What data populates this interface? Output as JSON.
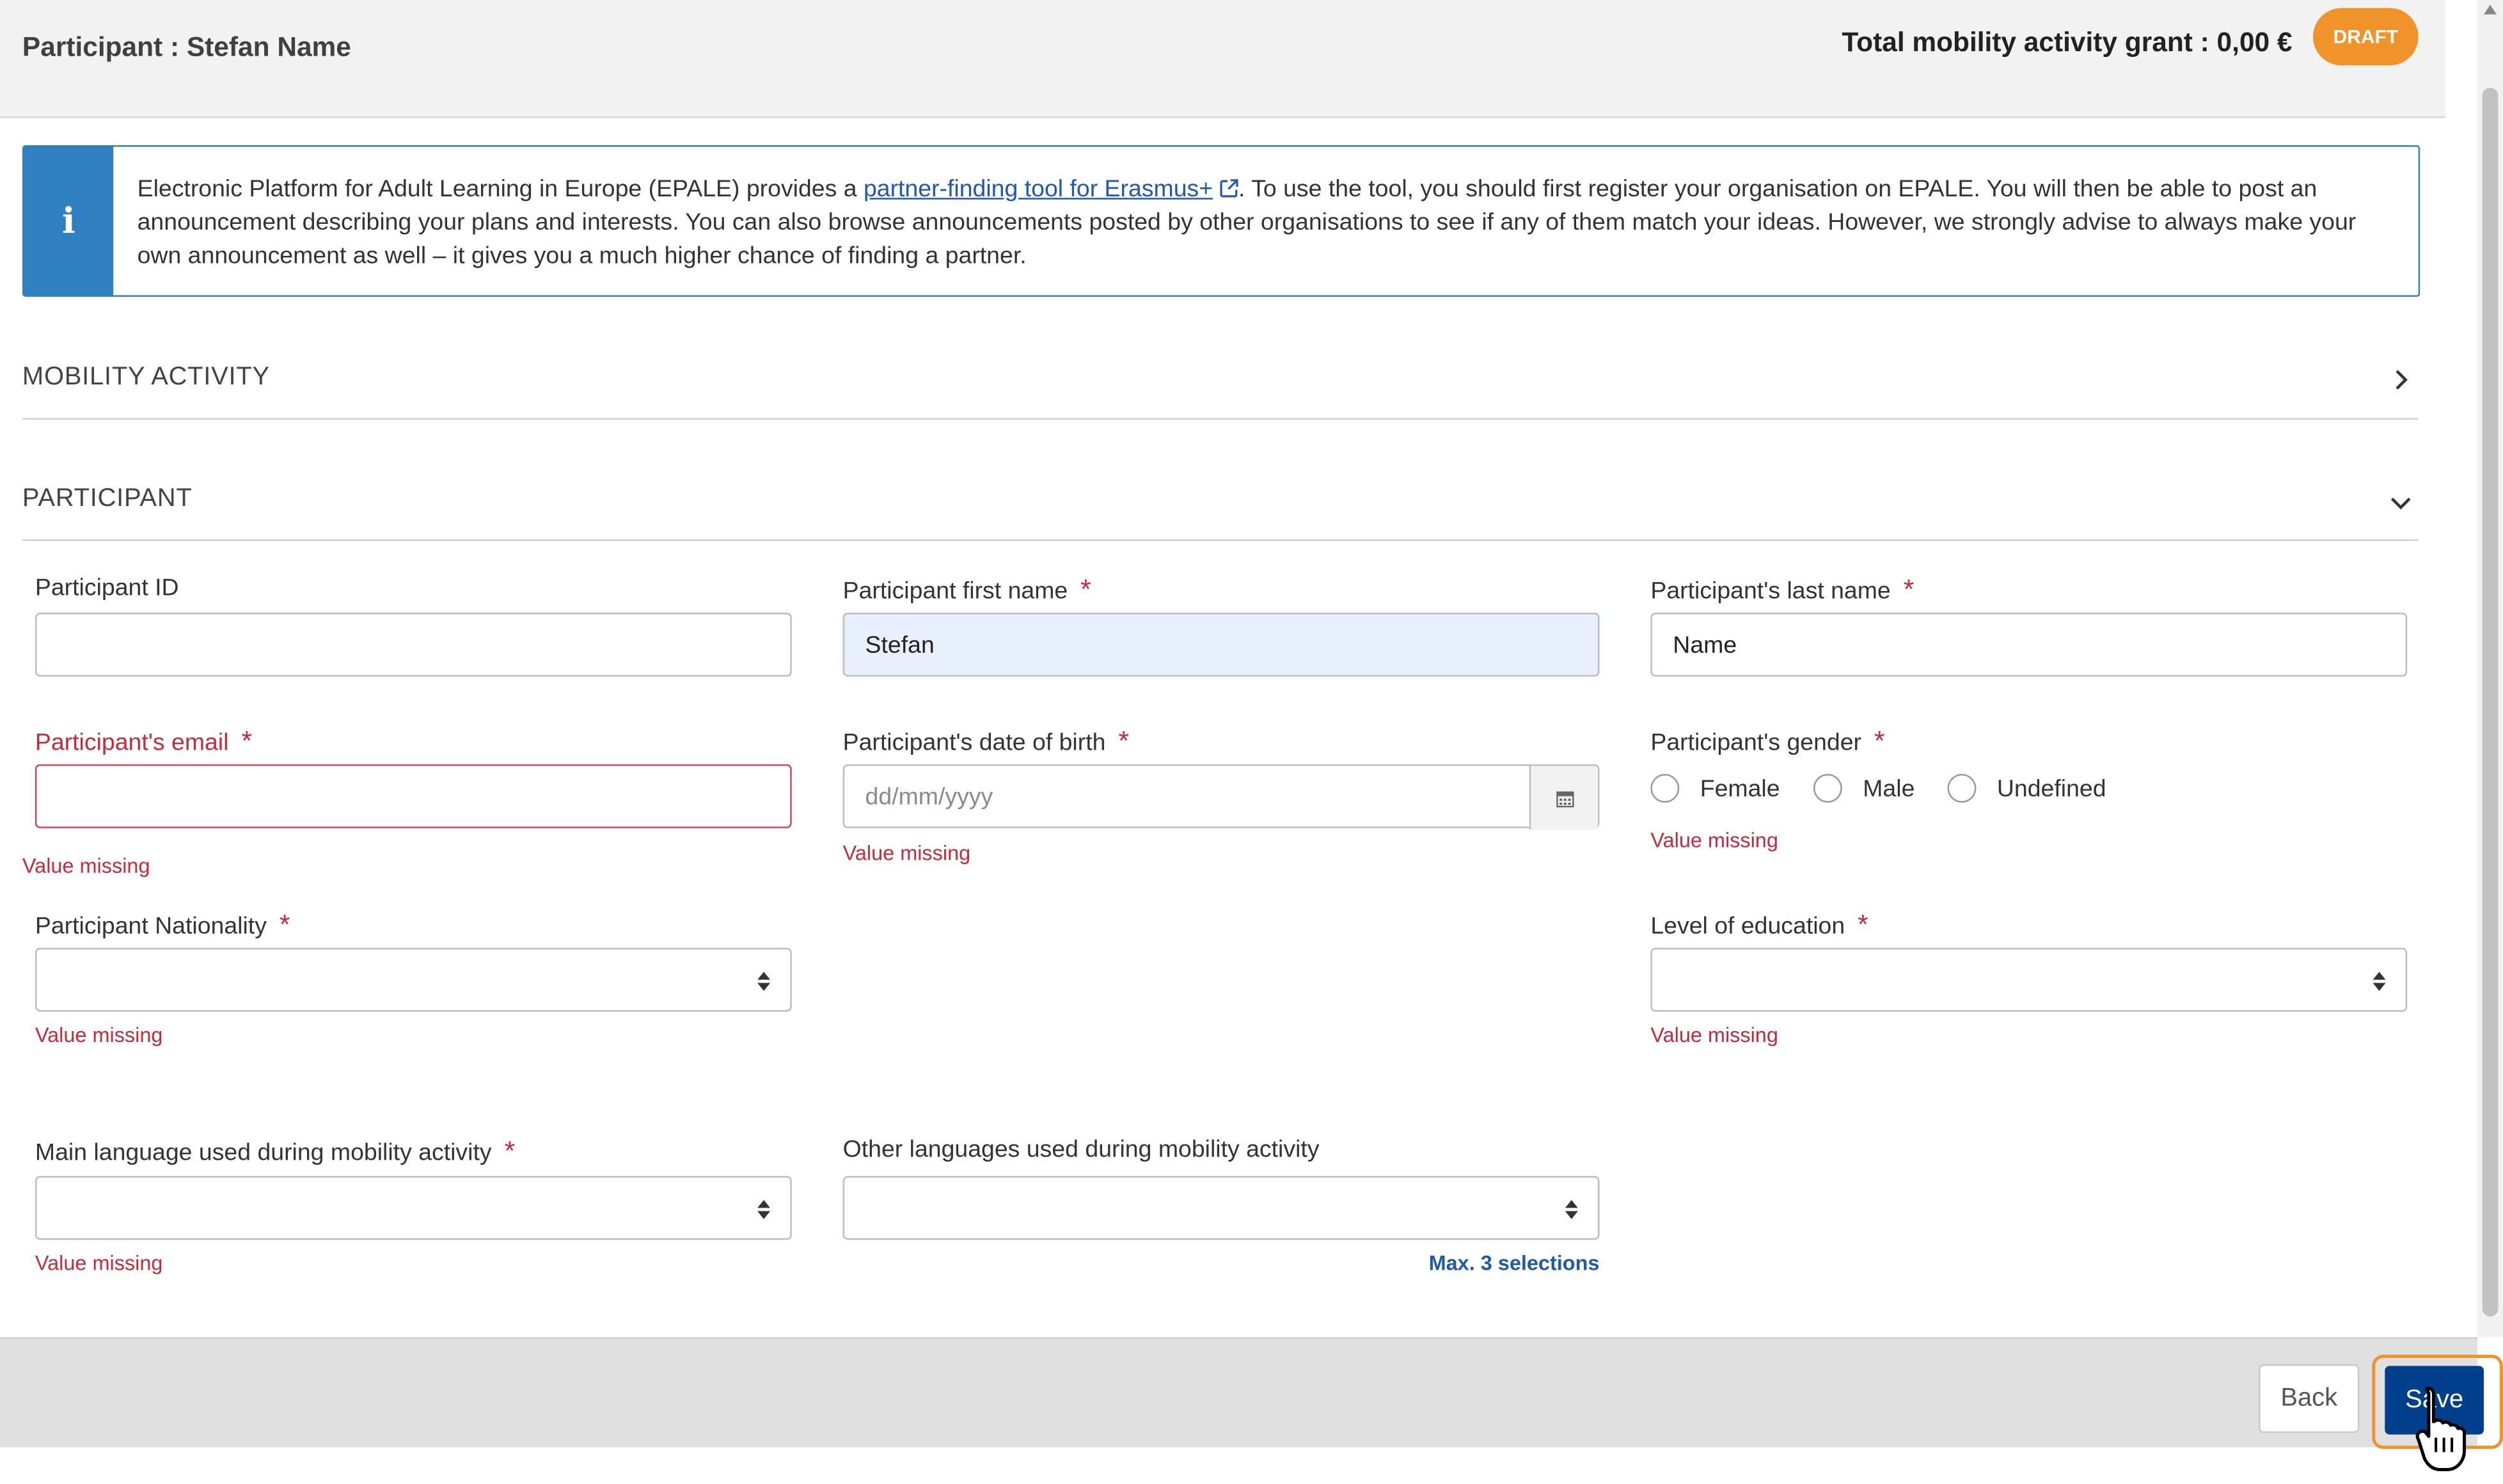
{
  "header": {
    "title": "Participant : Stefan Name",
    "grant": "Total mobility activity grant : 0,00 €",
    "status_badge": "DRAFT"
  },
  "info": {
    "text_before": "Electronic Platform for Adult Learning in Europe (EPALE) provides a ",
    "link": "partner-finding tool for Erasmus+",
    "text_after": ". To use the tool, you should first register your organisation on EPALE. You will then be able to post an announcement describing your plans and interests. You can also browse announcements posted by other organisations to see if any of them match your ideas. However, we strongly advise to always make your own announcement as well – it gives you a much higher chance of finding a partner."
  },
  "sections": {
    "mobility_activity": "MOBILITY ACTIVITY",
    "participant": "PARTICIPANT"
  },
  "form": {
    "participant_id": {
      "label": "Participant ID",
      "value": ""
    },
    "first_name": {
      "label": "Participant first name",
      "required": "*",
      "value": "Stefan"
    },
    "last_name": {
      "label": "Participant's last name",
      "required": "*",
      "value": "Name"
    },
    "email": {
      "label": "Participant's email",
      "required": "*",
      "value": "",
      "error": "Value missing"
    },
    "dob": {
      "label": "Participant's date of birth",
      "required": "*",
      "placeholder": "dd/mm/yyyy",
      "error": "Value missing"
    },
    "gender": {
      "label": "Participant's gender",
      "required": "*",
      "options": [
        "Female",
        "Male",
        "Undefined"
      ],
      "error": "Value missing"
    },
    "nationality": {
      "label": "Participant Nationality",
      "required": "*",
      "value": "",
      "error": "Value missing"
    },
    "education": {
      "label": "Level of education",
      "required": "*",
      "value": "",
      "error": "Value missing"
    },
    "main_language": {
      "label": "Main language used during mobility activity",
      "required": "*",
      "value": "",
      "error": "Value missing"
    },
    "other_languages": {
      "label": "Other languages used during mobility activity",
      "value": "",
      "hint": "Max. 3 selections"
    }
  },
  "footer": {
    "back_label": "Back",
    "save_label": "Save"
  },
  "icons": {
    "info": "info-icon",
    "external_link": "external-link-icon",
    "chevron_right": "chevron-right-icon",
    "chevron_down": "chevron-down-icon",
    "calendar": "calendar-icon",
    "select_arrows": "sort-arrows-icon",
    "cursor": "hand-pointer-cursor-icon"
  },
  "colors": {
    "accent_blue": "#2f7fc1",
    "primary_button": "#003f8c",
    "badge_orange": "#f0932b",
    "error_red": "#c62b3b",
    "autofill_bg": "#e8f0fe"
  }
}
